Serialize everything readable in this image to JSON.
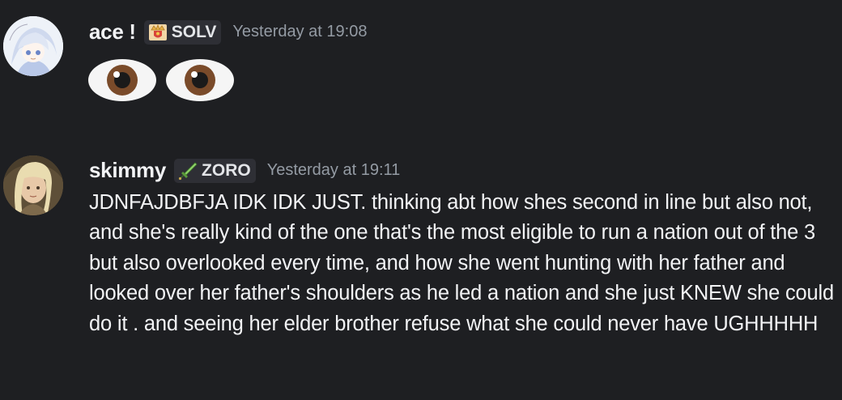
{
  "messages": [
    {
      "username": "ace !",
      "tag": {
        "label": "SOLV",
        "icon": "crown-shield-icon"
      },
      "timestamp": "Yesterday at 19:08",
      "content": {
        "emoji": [
          "eyes-emoji",
          "eyes-emoji"
        ]
      }
    },
    {
      "username": "skimmy",
      "tag": {
        "label": "ZORO",
        "icon": "green-sword-icon"
      },
      "timestamp": "Yesterday at 19:11",
      "content": {
        "text": "JDNFAJDBFJA IDK IDK JUST. thinking abt how shes second in line but also not, and she's really kind of the one that's the most eligible to run a nation out of the 3 but also overlooked every time, and how she went hunting with her father and looked over her father's shoulders as he led a nation and she just KNEW she could do it . and seeing her elder brother refuse what she could never have UGHHHHH"
      }
    }
  ],
  "colors": {
    "background": "#1e1f22",
    "username": "#f2f3f5",
    "timestamp": "#949ba4",
    "tag_bg": "#2e2f35"
  }
}
